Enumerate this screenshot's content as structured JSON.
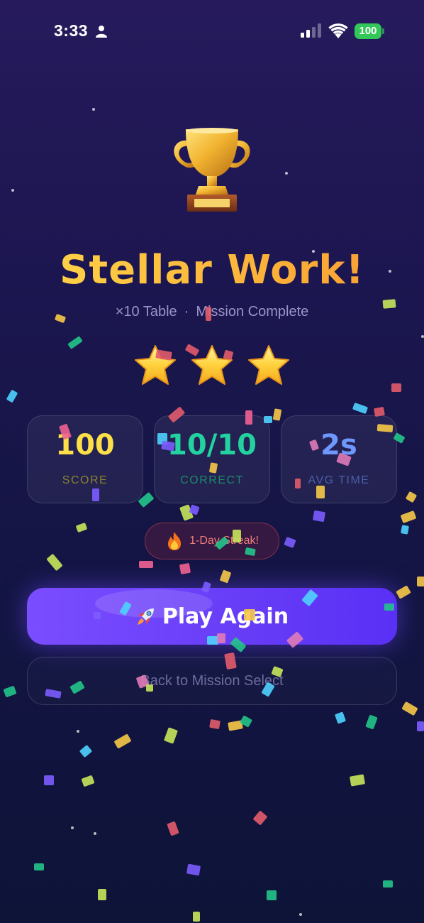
{
  "status_bar": {
    "time": "3:33",
    "battery": "100",
    "icons": [
      "person-icon",
      "signal-icon",
      "wifi-icon",
      "battery-icon"
    ]
  },
  "result": {
    "trophy_icon": "trophy-icon",
    "title": "Stellar Work!",
    "subtitle_table": "×10 Table",
    "subtitle_sep": "·",
    "subtitle_status": "Mission Complete",
    "stars_earned": 3,
    "stars_total": 3
  },
  "stats": [
    {
      "value": "100",
      "label": "SCORE"
    },
    {
      "value": "10/10",
      "label": "CORRECT"
    },
    {
      "value": "2s",
      "label": "AVG TIME"
    }
  ],
  "streak": {
    "icon": "fire-icon",
    "label": "1-Day Streak!"
  },
  "actions": {
    "play_again_icon": "rocket-icon",
    "play_again": "Play Again",
    "back": "Back to Mission Select"
  },
  "colors": {
    "title_gradient": [
      "#ffd84a",
      "#f89a30"
    ],
    "score": "#fde047",
    "correct": "#22d3a0",
    "avg_time": "#6f98ff",
    "primary_button": "#6a3ff8",
    "streak": "#ef7b7b"
  }
}
